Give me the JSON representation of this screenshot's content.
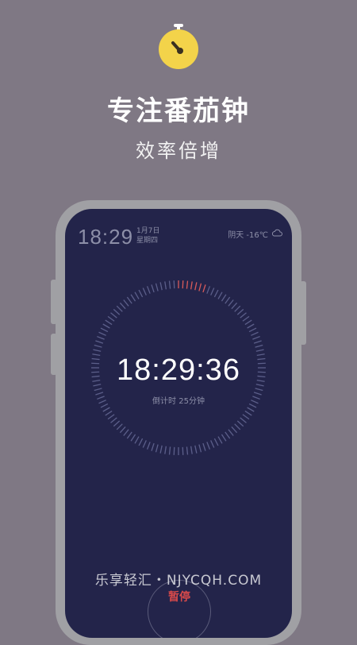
{
  "app": {
    "headline": "专注番茄钟",
    "subline": "效率倍增",
    "logo_icon": "stopwatch-icon",
    "accent_color": "#f3d34a"
  },
  "phone_screen": {
    "status_time": "18:29",
    "status_date_line1": "1月7日",
    "status_date_line2": "星期四",
    "weather": "阴天 -16℃",
    "weather_icon": "cloud-icon",
    "timer_display": "18:29:36",
    "countdown_label": "倒计时 25分钟",
    "pause_label": "暂停",
    "progress_fraction": 0.94,
    "ring_active_color": "#d85a5a",
    "ring_inactive_color": "#5c5f8a"
  },
  "watermark": "乐享轻汇・NJYCQH.COM"
}
